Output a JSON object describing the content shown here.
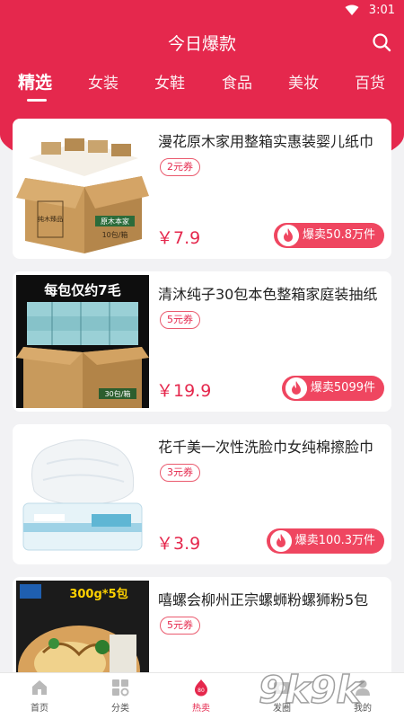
{
  "status_bar": {
    "time": "3:01"
  },
  "header": {
    "title": "今日爆款"
  },
  "tabs": [
    {
      "label": "精选"
    },
    {
      "label": "女装"
    },
    {
      "label": "女鞋"
    },
    {
      "label": "食品"
    },
    {
      "label": "美妆"
    },
    {
      "label": "百货"
    }
  ],
  "products": [
    {
      "title": "漫花原木家用整箱实惠装婴儿纸巾",
      "coupon": "2元券",
      "price": "￥7.9",
      "sales": "爆卖50.8万件",
      "image_text": [
        "原木本家",
        "10包/箱",
        "纯木臻品"
      ]
    },
    {
      "title": "清沐纯子30包本色整箱家庭装抽纸",
      "coupon": "5元券",
      "price": "￥19.9",
      "sales": "爆卖5099件",
      "image_text": [
        "每包仅约7毛",
        "30包/箱"
      ]
    },
    {
      "title": "花千美一次性洗脸巾女纯棉擦脸巾",
      "coupon": "3元券",
      "price": "￥3.9",
      "sales": "爆卖100.3万件",
      "image_text": []
    },
    {
      "title": "嘻螺会柳州正宗螺蛳粉螺狮粉5包",
      "coupon": "5元券",
      "price": "",
      "sales": "",
      "image_text": [
        "300g*5包"
      ]
    }
  ],
  "bottom_nav": [
    {
      "label": "首页",
      "icon": "home-icon"
    },
    {
      "label": "分类",
      "icon": "category-icon"
    },
    {
      "label": "热卖",
      "icon": "hot-icon",
      "badge": "80"
    },
    {
      "label": "发圈",
      "icon": "share-icon"
    },
    {
      "label": "我的",
      "icon": "profile-icon"
    }
  ],
  "watermark": "9k9k",
  "colors": {
    "brand": "#e5284d",
    "badge": "#ef4660",
    "background": "#f2f2f4"
  }
}
